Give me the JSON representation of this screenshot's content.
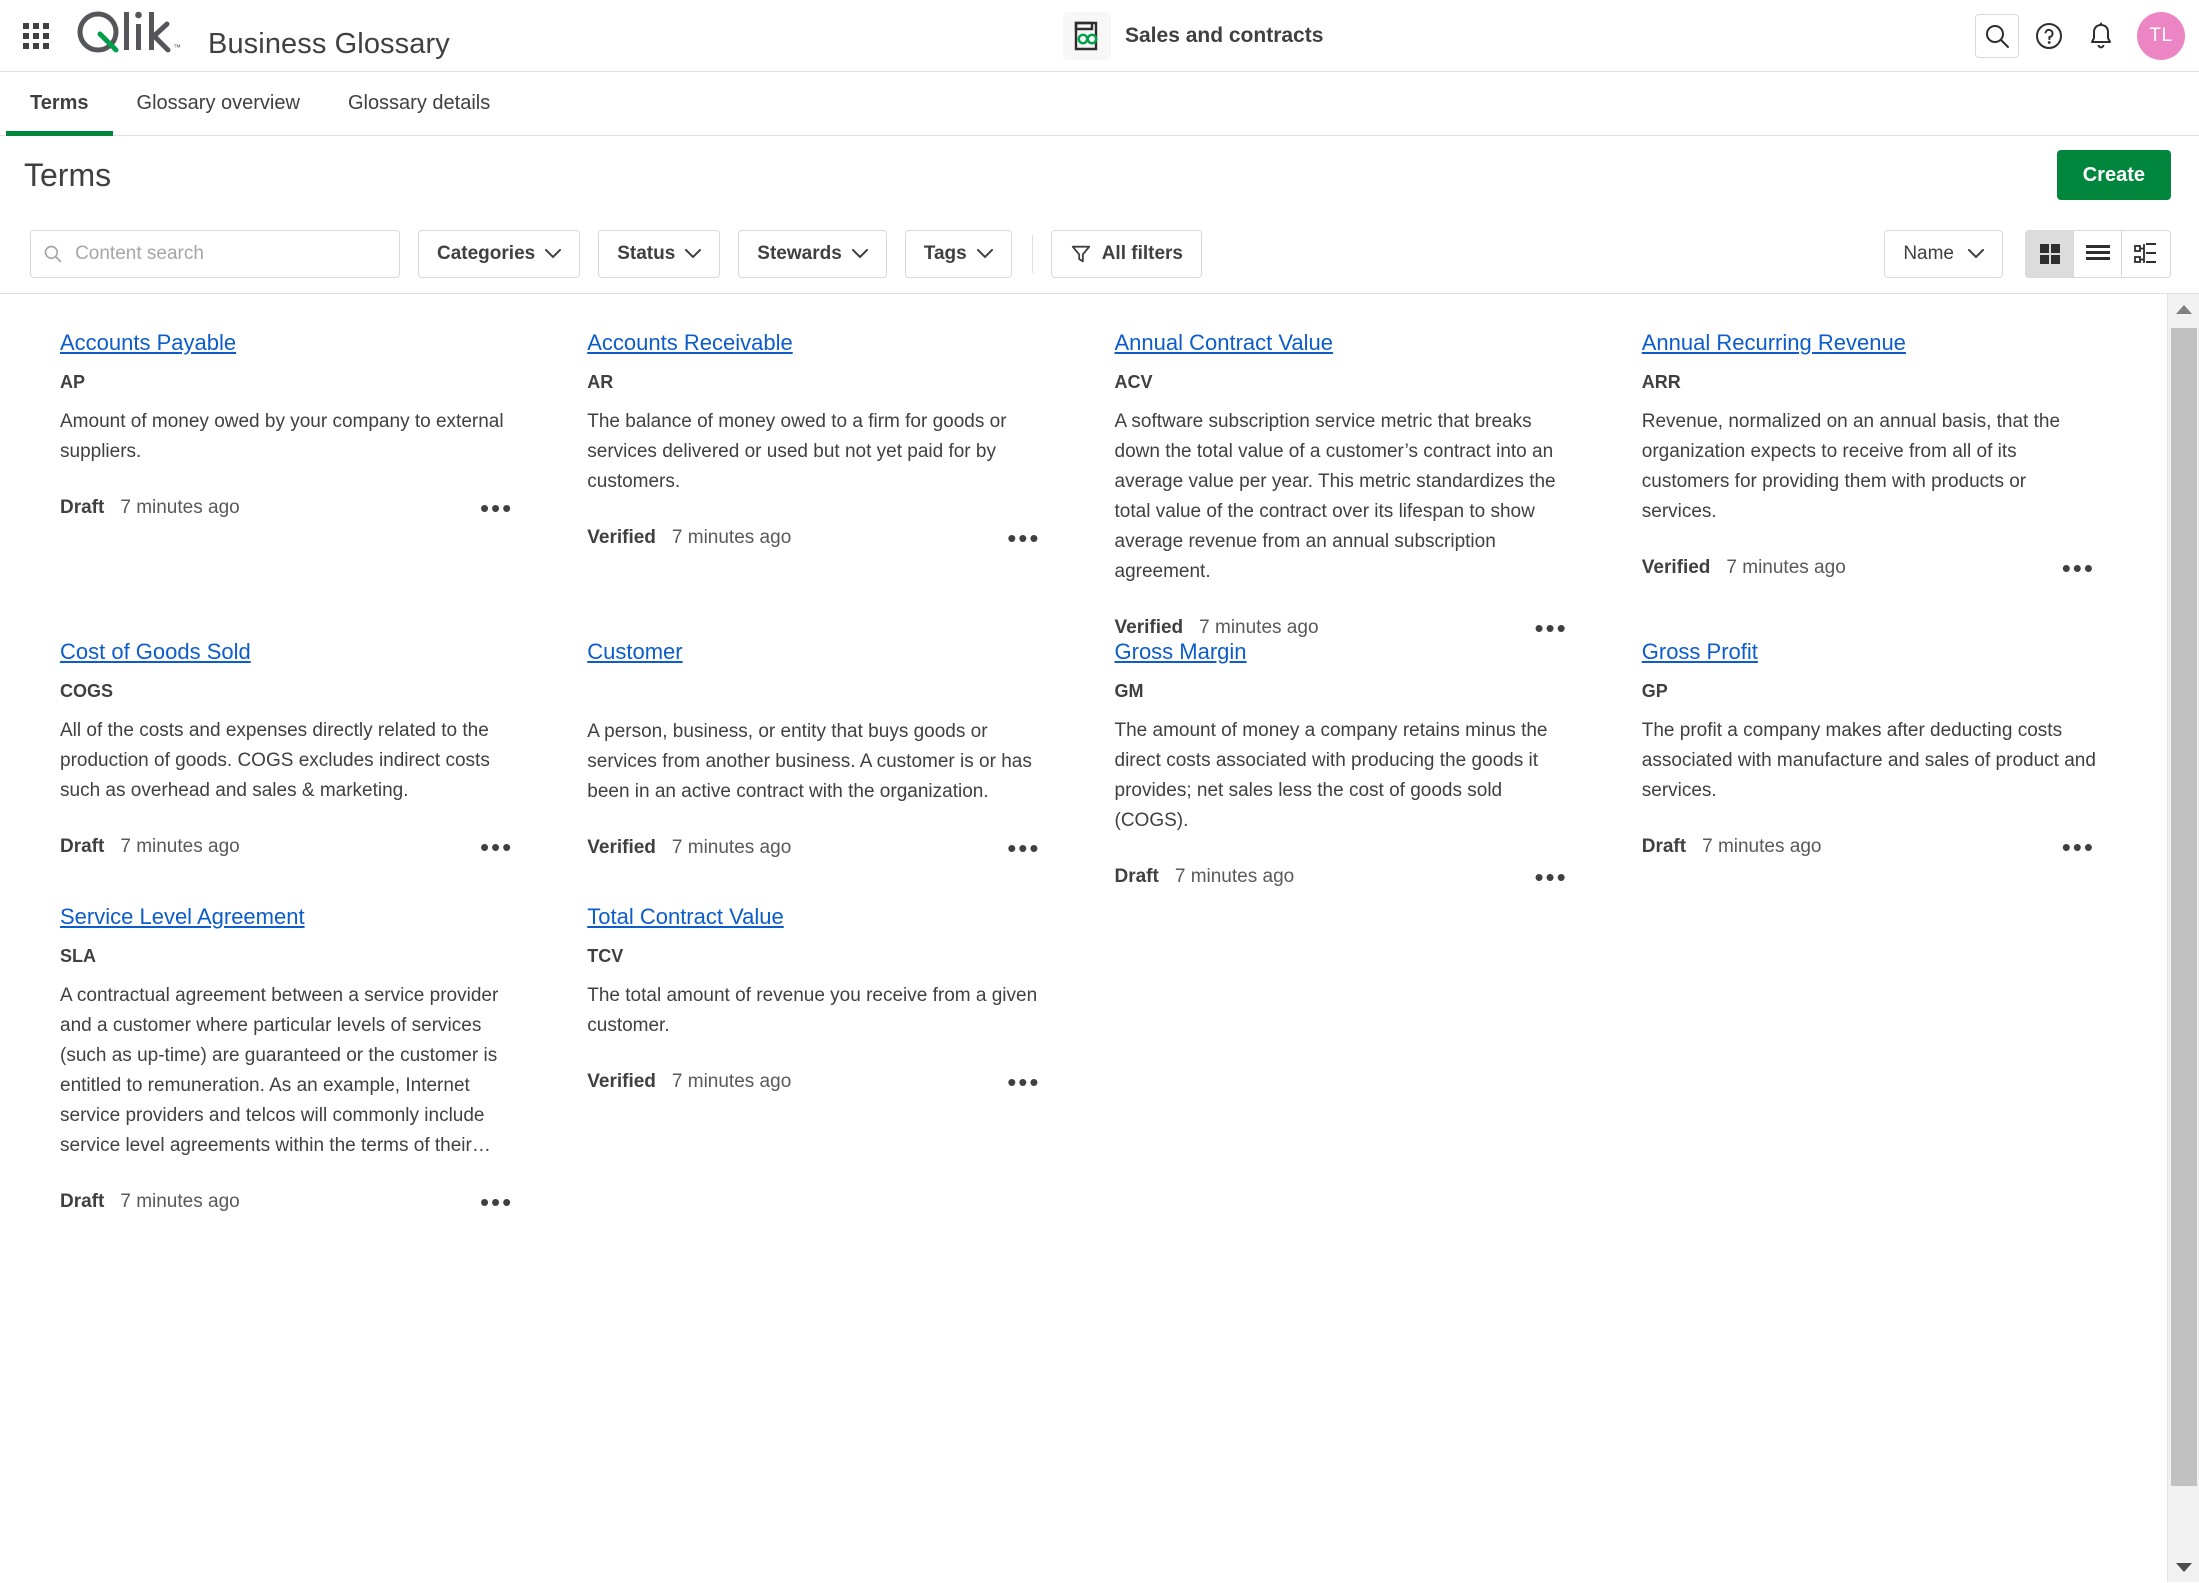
{
  "topbar": {
    "launcher_icon": "app-launcher-grid-icon",
    "logo_text": "Qlik",
    "app_title": "Business Glossary",
    "space": {
      "icon": "glossary-icon",
      "label": "Sales and contracts"
    },
    "actions": [
      {
        "icon": "search-icon",
        "name": "search-button"
      },
      {
        "icon": "help-circle-icon",
        "name": "help-button"
      },
      {
        "icon": "bell-icon",
        "name": "notifications-button"
      }
    ],
    "avatar_initials": "TL"
  },
  "tabs": [
    {
      "label": "Terms",
      "active": true
    },
    {
      "label": "Glossary overview",
      "active": false
    },
    {
      "label": "Glossary details",
      "active": false
    }
  ],
  "page": {
    "title": "Terms",
    "create_label": "Create"
  },
  "toolbar": {
    "search_placeholder": "Content search",
    "search_value": "",
    "filters": [
      {
        "label": "Categories"
      },
      {
        "label": "Status"
      },
      {
        "label": "Stewards"
      },
      {
        "label": "Tags"
      }
    ],
    "all_filters_label": "All filters",
    "sort_label": "Name",
    "views": [
      {
        "name": "grid-view",
        "icon": "grid-view-icon",
        "active": true
      },
      {
        "name": "list-view",
        "icon": "list-view-icon",
        "active": false
      },
      {
        "name": "tree-view",
        "icon": "tree-view-icon",
        "active": false
      }
    ]
  },
  "terms": [
    {
      "title": "Accounts Payable",
      "abbr": "AP",
      "description": "Amount of money owed by your company to external suppliers.",
      "status": "Draft",
      "time": "7 minutes ago"
    },
    {
      "title": "Accounts Receivable",
      "abbr": "AR",
      "description": "The balance of money owed to a firm for goods or services delivered or used but not yet paid for by customers.",
      "status": "Verified",
      "time": "7 minutes ago"
    },
    {
      "title": "Annual Contract Value",
      "abbr": "ACV",
      "description": "A software subscription service metric that breaks down the total value of a customer’s contract into an average value per year. This metric standardizes the total value of the contract over its lifespan to show average revenue from an annual subscription agreement.",
      "status": "Verified",
      "time": "7 minutes ago"
    },
    {
      "title": "Annual Recurring Revenue",
      "abbr": "ARR",
      "description": "Revenue, normalized on an annual basis, that the organization expects to receive from all of its customers for providing them with products or services.",
      "status": "Verified",
      "time": "7 minutes ago"
    },
    {
      "title": "Cost of Goods Sold",
      "abbr": "COGS",
      "description": "All of the costs and expenses directly related to the production of goods. COGS excludes indirect costs such as overhead and sales & marketing.",
      "status": "Draft",
      "time": "7 minutes ago"
    },
    {
      "title": "Customer",
      "abbr": "",
      "description": "A person, business, or entity that buys goods or services from another business. A customer is or has been in an active contract with the organization.",
      "status": "Verified",
      "time": "7 minutes ago"
    },
    {
      "title": "Gross Margin",
      "abbr": "GM",
      "description": "The amount of money a company retains minus the direct costs associated with producing the goods it provides; net sales less the cost of goods sold (COGS).",
      "status": "Draft",
      "time": "7 minutes ago"
    },
    {
      "title": "Gross Profit",
      "abbr": "GP",
      "description": "The profit a company makes after deducting costs associated with manufacture and sales of product and services.",
      "status": "Draft",
      "time": "7 minutes ago"
    },
    {
      "title": "Service Level Agreement",
      "abbr": "SLA",
      "description": "A contractual agreement between a service provider and a customer where particular levels of services (such as up-time) are guaranteed or the customer is entitled to remuneration. As an example, Internet service providers and telcos will commonly include service level agreements within the terms of their…",
      "status": "Draft",
      "time": "7 minutes ago"
    },
    {
      "title": "Total Contract Value",
      "abbr": "TCV",
      "description": "The total amount of revenue you receive from a given customer.",
      "status": "Verified",
      "time": "7 minutes ago"
    }
  ],
  "card_menu_glyph": "•••",
  "colors": {
    "brand_green": "#00873D",
    "link_blue": "#0C5CCC",
    "avatar_pink": "#EB85C4",
    "text": "#404040"
  }
}
